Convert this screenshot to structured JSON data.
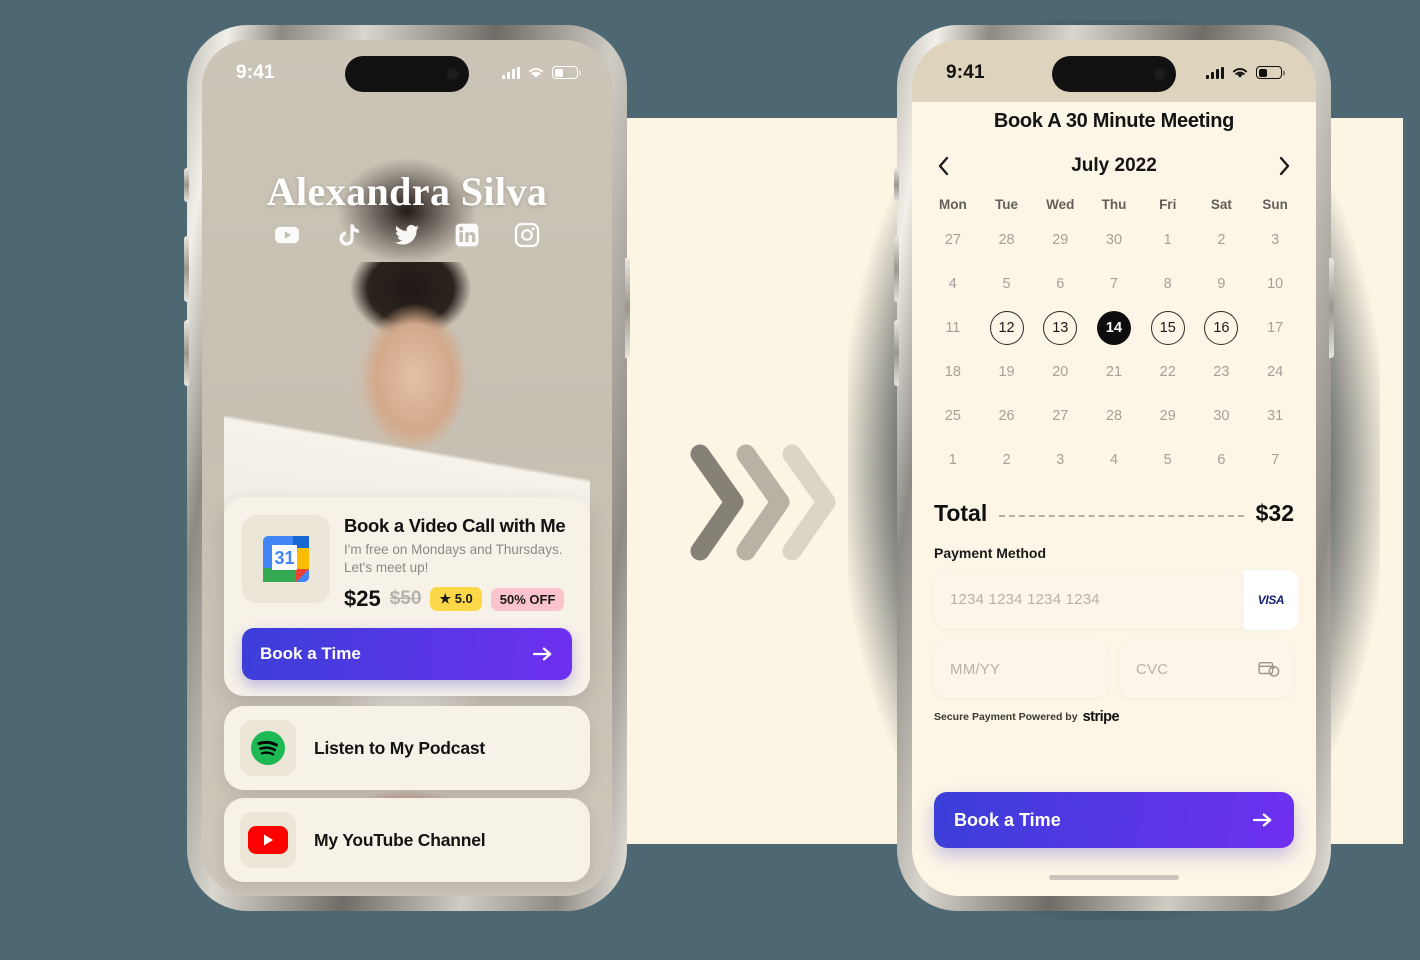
{
  "theme": {
    "background": "#4d6872",
    "panel": "#fcf5e4",
    "accent_gradient_start": "#3b3fd8",
    "accent_gradient_end": "#6f2ff0",
    "card_surface": "#f7f2e8",
    "right_screen": "#fdf6e6",
    "rating_pill": "#fcd748",
    "discount_pill": "#fbc3cb"
  },
  "arrows": {
    "name": "chevron-right-triple",
    "count": 3,
    "opacities": [
      "0.62",
      "0.38",
      "0.20"
    ]
  },
  "left_phone": {
    "status": {
      "time": "9:41",
      "signal_icon": "cellular-bars-icon",
      "wifi_icon": "wifi-icon",
      "battery_icon": "battery-icon"
    },
    "profile": {
      "name": "Alexandra Silva",
      "socials": [
        {
          "name": "youtube-icon",
          "label": "YouTube"
        },
        {
          "name": "tiktok-icon",
          "label": "TikTok"
        },
        {
          "name": "twitter-icon",
          "label": "Twitter"
        },
        {
          "name": "linkedin-icon",
          "label": "LinkedIn"
        },
        {
          "name": "instagram-icon",
          "label": "Instagram"
        }
      ]
    },
    "booking_card": {
      "icon": "google-calendar-icon",
      "icon_day": "31",
      "title": "Book a Video Call with Me",
      "subtitle": "I'm free on Mondays and Thursdays. Let's meet up!",
      "price": "$25",
      "original_price": "$50",
      "rating": "★ 5.0",
      "discount": "50% OFF",
      "cta_label": "Book a Time"
    },
    "links": [
      {
        "icon": "spotify-icon",
        "label": "Listen to My Podcast"
      },
      {
        "icon": "youtube-icon",
        "label": "My YouTube Channel"
      }
    ]
  },
  "right_phone": {
    "status": {
      "time": "9:41",
      "signal_icon": "cellular-bars-icon",
      "wifi_icon": "wifi-icon",
      "battery_icon": "battery-icon"
    },
    "title": "Book A 30 Minute Meeting",
    "calendar": {
      "month_label": "July 2022",
      "prev_icon": "chevron-left-icon",
      "next_icon": "chevron-right-icon",
      "day_headers": [
        "Mon",
        "Tue",
        "Wed",
        "Thu",
        "Fri",
        "Sat",
        "Sun"
      ],
      "weeks": [
        [
          {
            "d": "27",
            "state": "muted"
          },
          {
            "d": "28",
            "state": "muted"
          },
          {
            "d": "29",
            "state": "muted"
          },
          {
            "d": "30",
            "state": "muted"
          },
          {
            "d": "1",
            "state": "muted"
          },
          {
            "d": "2",
            "state": "muted"
          },
          {
            "d": "3",
            "state": "muted"
          }
        ],
        [
          {
            "d": "4",
            "state": "muted"
          },
          {
            "d": "5",
            "state": "muted"
          },
          {
            "d": "6",
            "state": "muted"
          },
          {
            "d": "7",
            "state": "muted"
          },
          {
            "d": "8",
            "state": "muted"
          },
          {
            "d": "9",
            "state": "muted"
          },
          {
            "d": "10",
            "state": "muted"
          }
        ],
        [
          {
            "d": "11",
            "state": "muted"
          },
          {
            "d": "12",
            "state": "available"
          },
          {
            "d": "13",
            "state": "available"
          },
          {
            "d": "14",
            "state": "selected"
          },
          {
            "d": "15",
            "state": "available"
          },
          {
            "d": "16",
            "state": "available"
          },
          {
            "d": "17",
            "state": "muted"
          }
        ],
        [
          {
            "d": "18",
            "state": "muted"
          },
          {
            "d": "19",
            "state": "muted"
          },
          {
            "d": "20",
            "state": "muted"
          },
          {
            "d": "21",
            "state": "muted"
          },
          {
            "d": "22",
            "state": "muted"
          },
          {
            "d": "23",
            "state": "muted"
          },
          {
            "d": "24",
            "state": "muted"
          }
        ],
        [
          {
            "d": "25",
            "state": "muted"
          },
          {
            "d": "26",
            "state": "muted"
          },
          {
            "d": "27",
            "state": "muted"
          },
          {
            "d": "28",
            "state": "muted"
          },
          {
            "d": "29",
            "state": "muted"
          },
          {
            "d": "30",
            "state": "muted"
          },
          {
            "d": "31",
            "state": "muted"
          }
        ],
        [
          {
            "d": "1",
            "state": "muted"
          },
          {
            "d": "2",
            "state": "muted"
          },
          {
            "d": "3",
            "state": "muted"
          },
          {
            "d": "4",
            "state": "muted"
          },
          {
            "d": "5",
            "state": "muted"
          },
          {
            "d": "6",
            "state": "muted"
          },
          {
            "d": "7",
            "state": "muted"
          }
        ]
      ]
    },
    "total": {
      "label": "Total",
      "amount": "$32"
    },
    "payment": {
      "section_label": "Payment Method",
      "card_number_placeholder": "1234 1234 1234 1234",
      "card_brand": "VISA",
      "expiry_placeholder": "MM/YY",
      "cvc_placeholder": "CVC",
      "cvc_icon": "card-cvc-icon",
      "secure_text": "Secure Payment Powered by",
      "provider": "stripe"
    },
    "cta_label": "Book a Time",
    "home_indicator": "home-bar"
  }
}
